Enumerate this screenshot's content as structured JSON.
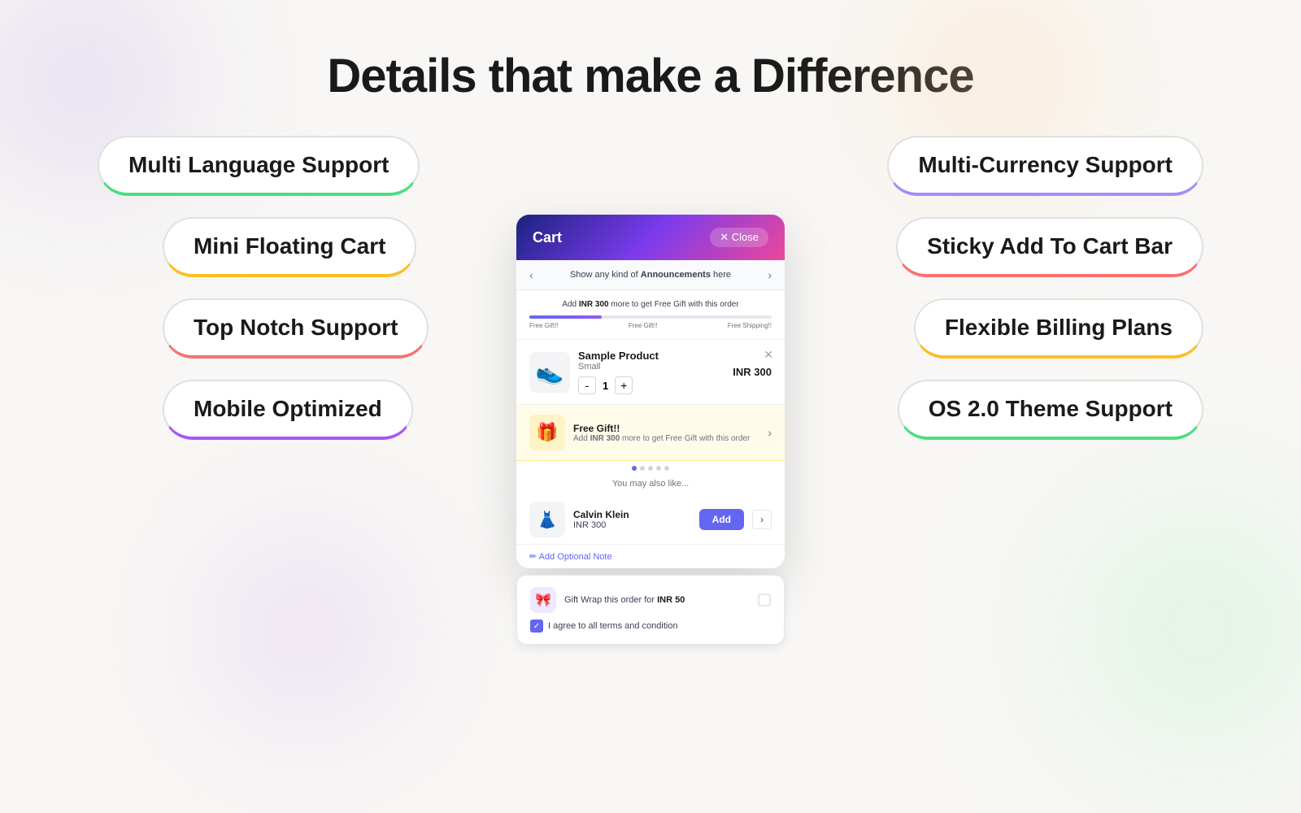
{
  "page": {
    "title": "Details that make a Difference",
    "background": "#f8f7f5"
  },
  "features_left": [
    {
      "id": "multi-language",
      "label": "Multi Language Support",
      "border_color": "#4ade80"
    },
    {
      "id": "mini-floating",
      "label": "Mini Floating Cart",
      "border_color": "#fbbf24"
    },
    {
      "id": "top-notch",
      "label": "Top Notch Support",
      "border_color": "#f87171"
    },
    {
      "id": "mobile-optimized",
      "label": "Mobile Optimized",
      "border_color": "#a855f7"
    }
  ],
  "features_right": [
    {
      "id": "multi-currency",
      "label": "Multi-Currency Support",
      "border_color": "#a78bfa"
    },
    {
      "id": "sticky-cart",
      "label": "Sticky Add To Cart Bar",
      "border_color": "#f87171"
    },
    {
      "id": "flexible-billing",
      "label": "Flexible Billing Plans",
      "border_color": "#fbbf24"
    },
    {
      "id": "os-theme",
      "label": "OS 2.0 Theme Support",
      "border_color": "#4ade80"
    }
  ],
  "cart_ui": {
    "title": "Cart",
    "close_label": "✕ Close",
    "announcement": {
      "text": "Show any kind of ",
      "bold": "Announcements",
      "text2": " here"
    },
    "progress": {
      "message_pre": "Add ",
      "amount": "INR 300",
      "message_post": " more to get Free Gift with this order",
      "labels": [
        "Free Gift!!",
        "Free Gift!!",
        "Free Shipping!!"
      ]
    },
    "cart_item": {
      "name": "Sample Product",
      "variant": "Small",
      "qty": "1",
      "price": "INR 300",
      "image": "👟"
    },
    "free_gift": {
      "name": "Free Gift!!",
      "desc_pre": "Add ",
      "amount": "INR 300",
      "desc_post": " more to get Free Gift with this order",
      "image": "🎁"
    },
    "you_may_like": "You may also like...",
    "recommendation": {
      "name": "Calvin Klein",
      "price": "INR 300",
      "image": "👗",
      "add_label": "Add"
    },
    "note_label": "✏ Add Optional Note"
  },
  "bottom_bar": {
    "gift_wrap_pre": "Gift Wrap this order for ",
    "gift_wrap_price": "INR 50",
    "terms_label": "I agree to all terms and condition"
  }
}
